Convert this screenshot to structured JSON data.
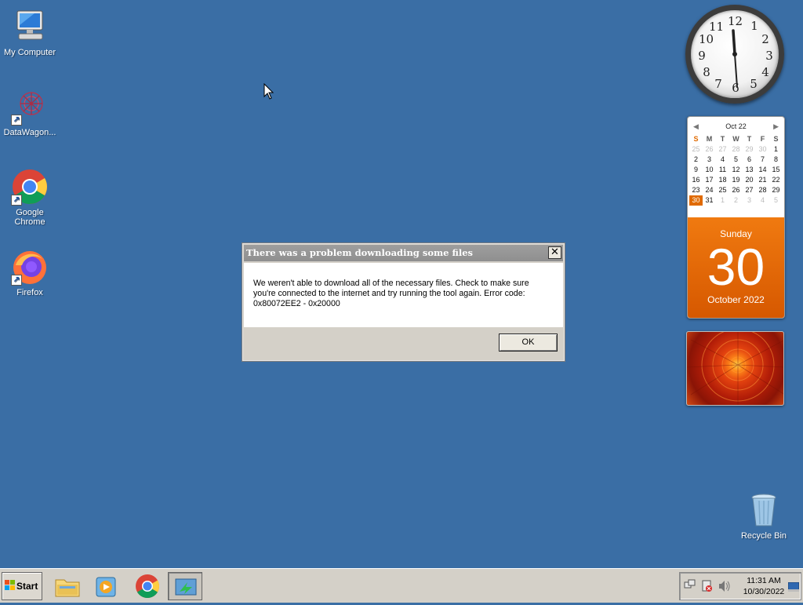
{
  "desktop": {
    "icons": [
      {
        "label": "My Computer"
      },
      {
        "label": "DataWagon..."
      },
      {
        "label": "Google Chrome"
      },
      {
        "label": "Firefox"
      },
      {
        "label": "Recycle Bin"
      }
    ]
  },
  "gadgets": {
    "clock": {
      "numerals": [
        "12",
        "1",
        "2",
        "3",
        "4",
        "5",
        "6",
        "7",
        "8",
        "9",
        "10",
        "11"
      ],
      "time": "11:31"
    },
    "calendar": {
      "month_label": "Oct 22",
      "weekdays": [
        "S",
        "M",
        "T",
        "W",
        "T",
        "F",
        "S"
      ],
      "weeks": [
        [
          "25",
          "26",
          "27",
          "28",
          "29",
          "30",
          "1"
        ],
        [
          "2",
          "3",
          "4",
          "5",
          "6",
          "7",
          "8"
        ],
        [
          "9",
          "10",
          "11",
          "12",
          "13",
          "14",
          "15"
        ],
        [
          "16",
          "17",
          "18",
          "19",
          "20",
          "21",
          "22"
        ],
        [
          "23",
          "24",
          "25",
          "26",
          "27",
          "28",
          "29"
        ],
        [
          "30",
          "31",
          "1",
          "2",
          "3",
          "4",
          "5"
        ]
      ],
      "day_name": "Sunday",
      "day_number": "30",
      "month_year": "October 2022"
    }
  },
  "dialog": {
    "title": "There was a problem downloading some files",
    "message": "We weren't able to download all of the necessary files. Check to make sure you're connected to the internet and try running the tool again. Error code: 0x80072EE2 - 0x20000",
    "ok_label": "OK",
    "close_glyph": "✕"
  },
  "taskbar": {
    "start_label": "Start",
    "buttons": [
      {
        "icon": "file-explorer-icon"
      },
      {
        "icon": "media-player-icon"
      },
      {
        "icon": "chrome-icon"
      },
      {
        "icon": "media-creation-tool-icon"
      }
    ],
    "clock_time": "11:31 AM",
    "clock_date": "10/30/2022"
  },
  "colors": {
    "desktop": "#3a6ea5",
    "accent_orange": "#e06a00"
  }
}
